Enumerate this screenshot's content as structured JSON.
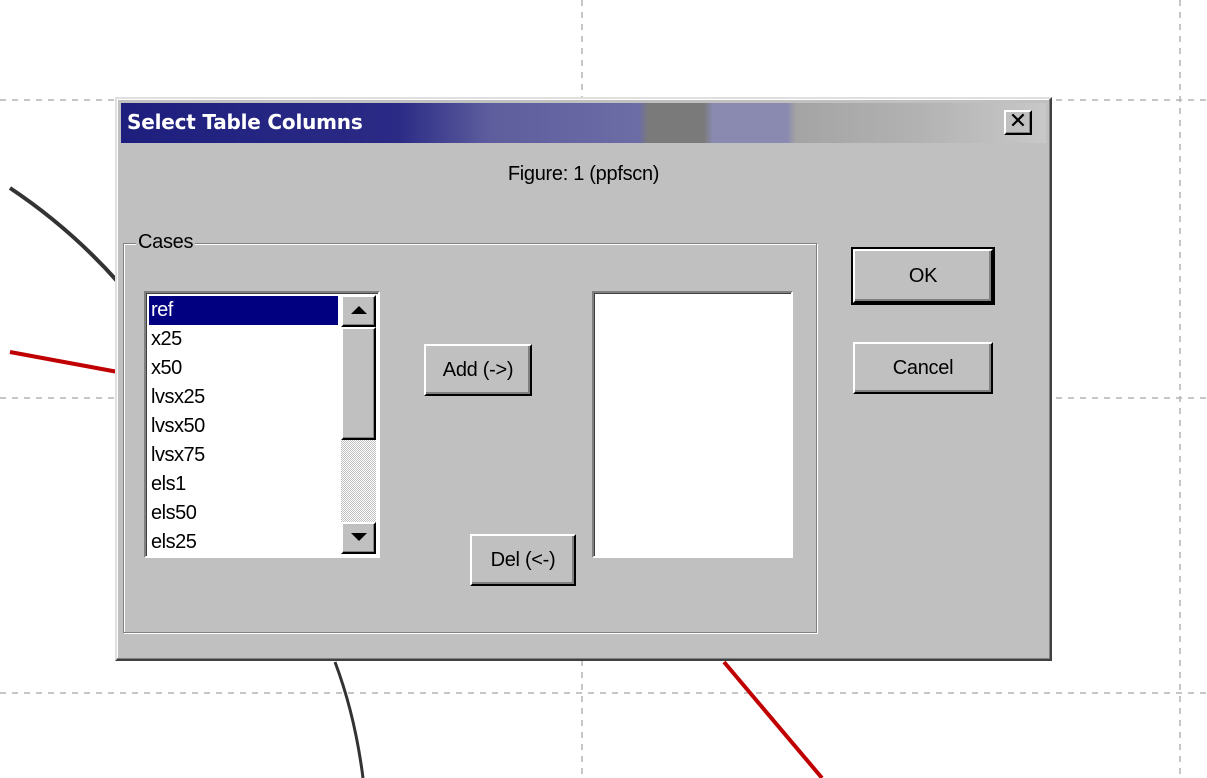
{
  "dialog": {
    "title": "Select Table Columns",
    "close_symbol": "✕",
    "figure_label": "Figure: 1 (ppfscn)",
    "group_label": "Cases",
    "available_items": [
      {
        "label": "ref",
        "selected": true
      },
      {
        "label": "x25",
        "selected": false
      },
      {
        "label": "x50",
        "selected": false
      },
      {
        "label": "lvsx25",
        "selected": false
      },
      {
        "label": "lvsx50",
        "selected": false
      },
      {
        "label": "lvsx75",
        "selected": false
      },
      {
        "label": "els1",
        "selected": false
      },
      {
        "label": "els50",
        "selected": false
      },
      {
        "label": "els25",
        "selected": false
      }
    ],
    "selected_items": [],
    "add_label": "Add (->)",
    "del_label": "Del (<-)",
    "ok_label": "OK",
    "cancel_label": "Cancel"
  },
  "colors": {
    "title_bar": "#000080",
    "selection": "#000080",
    "dialog_face": "#c0c0c0",
    "plot_line_dark": "#333333",
    "plot_line_red": "#c00000",
    "grid": "#b4b4b4"
  }
}
